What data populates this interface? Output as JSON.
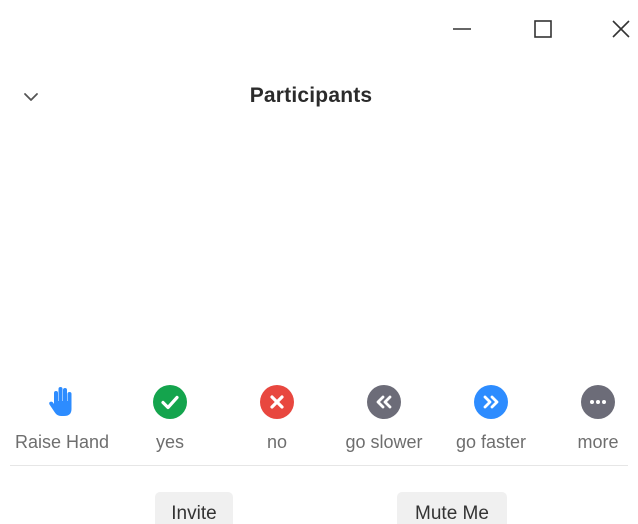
{
  "window": {
    "controls": {
      "minimize_icon": "minimize-icon",
      "maximize_icon": "maximize-icon",
      "close_icon": "close-icon"
    }
  },
  "header": {
    "title": "Participants",
    "collapse_icon": "chevron-down-icon"
  },
  "reactions": [
    {
      "label": "Raise Hand",
      "icon": "raise-hand-icon",
      "color": "#2D8CFF"
    },
    {
      "label": "yes",
      "icon": "check-icon",
      "color": "#14A44D"
    },
    {
      "label": "no",
      "icon": "x-icon",
      "color": "#E8473F"
    },
    {
      "label": "go slower",
      "icon": "go-slower-icon",
      "color": "#6C6C78"
    },
    {
      "label": "go faster",
      "icon": "go-faster-icon",
      "color": "#2D8CFF"
    },
    {
      "label": "more",
      "icon": "more-icon",
      "color": "#6C6C78"
    }
  ],
  "footer": {
    "invite_label": "Invite",
    "mute_label": "Mute Me"
  }
}
